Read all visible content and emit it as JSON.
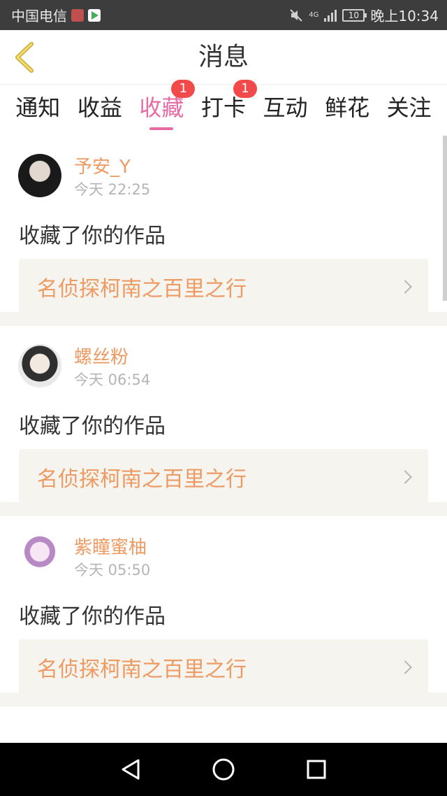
{
  "status_bar": {
    "carrier": "中国电信",
    "network": "4G",
    "battery": "10",
    "time": "晚上10:34"
  },
  "header": {
    "title": "消息"
  },
  "tabs": [
    {
      "label": "通知",
      "badge": ""
    },
    {
      "label": "收益",
      "badge": ""
    },
    {
      "label": "收藏",
      "badge": "1",
      "active": true
    },
    {
      "label": "打卡",
      "badge": "1"
    },
    {
      "label": "互动",
      "badge": ""
    },
    {
      "label": "鲜花",
      "badge": ""
    },
    {
      "label": "关注",
      "badge": ""
    }
  ],
  "feed": [
    {
      "user": "予安_Y",
      "time": "今天 22:25",
      "action": "收藏了你的作品",
      "work": "名侦探柯南之百里之行"
    },
    {
      "user": "螺丝粉",
      "time": "今天 06:54",
      "action": "收藏了你的作品",
      "work": "名侦探柯南之百里之行"
    },
    {
      "user": "紫瞳蜜柚",
      "time": "今天 05:50",
      "action": "收藏了你的作品",
      "work": "名侦探柯南之百里之行"
    }
  ],
  "colors": {
    "accent_pink": "#e86ba3",
    "accent_orange": "#ee9a63",
    "badge_red": "#f24a4a"
  },
  "icons": {
    "back": "chevron-left-icon",
    "nav_back": "triangle-back-icon",
    "nav_home": "circle-home-icon",
    "nav_recent": "square-recent-icon"
  }
}
